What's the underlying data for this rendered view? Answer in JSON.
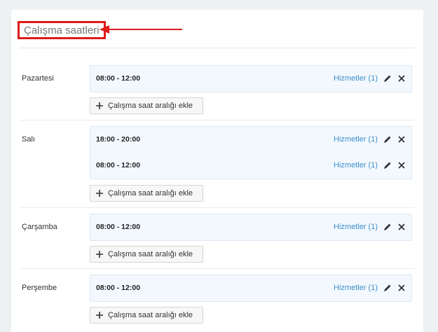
{
  "title": "Çalışma saatleri",
  "add_label": "Çalışma saat aralığı ekle",
  "days": [
    {
      "name": "Pazartesi",
      "slots": [
        {
          "time": "08:00 - 12:00",
          "services": "Hizmetler (1)"
        }
      ]
    },
    {
      "name": "Salı",
      "slots": [
        {
          "time": "18:00 - 20:00",
          "services": "Hizmetler (1)"
        },
        {
          "time": "08:00 - 12:00",
          "services": "Hizmetler (1)"
        }
      ]
    },
    {
      "name": "Çarşamba",
      "slots": [
        {
          "time": "08:00 - 12:00",
          "services": "Hizmetler (1)"
        }
      ]
    },
    {
      "name": "Perşembe",
      "slots": [
        {
          "time": "08:00 - 12:00",
          "services": "Hizmetler (1)"
        }
      ]
    }
  ],
  "colors": {
    "link": "#3d8fcc",
    "highlight": "#e01a1a",
    "slot_bg": "#f2f8fd"
  },
  "icons": {
    "edit": "pencil-icon",
    "remove": "close-icon",
    "add": "plus-icon",
    "annotation": "arrow-icon"
  }
}
